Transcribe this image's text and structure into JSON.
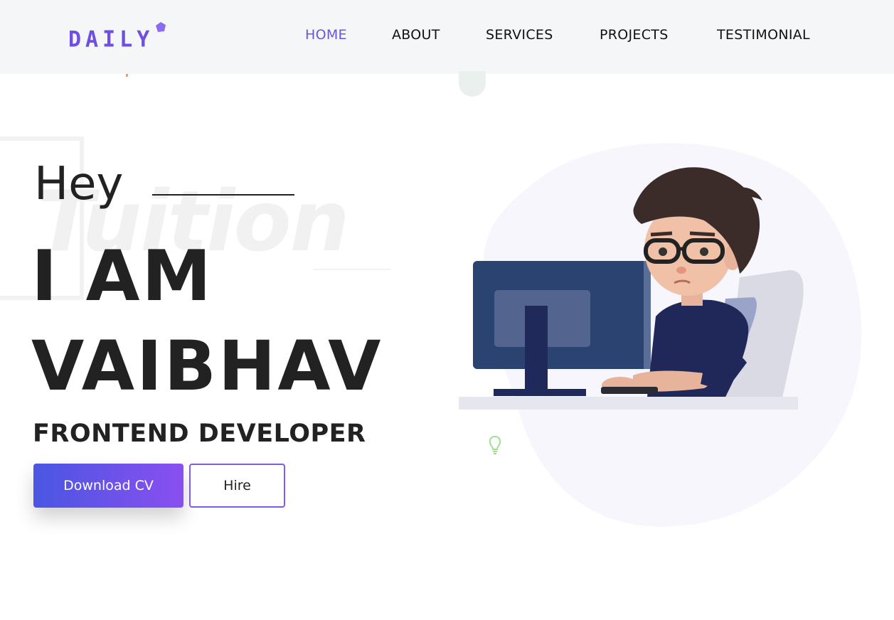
{
  "brand": {
    "logo_text": "DAILY",
    "accent": "#6f4ee4"
  },
  "nav": {
    "items": [
      {
        "label": "HOME",
        "active": true
      },
      {
        "label": "ABOUT",
        "active": false
      },
      {
        "label": "SERVICES",
        "active": false
      },
      {
        "label": "PROJECTS",
        "active": false
      },
      {
        "label": "TESTIMONIAL",
        "active": false
      }
    ],
    "active_color": "#6a55e0"
  },
  "hero": {
    "background_word": "Tuition",
    "greeting": "Hey",
    "title_line1": "I AM",
    "title_line2": "VAIBHAV",
    "subtitle": "FRONTEND DEVELOPER",
    "primary_button": "Download CV",
    "secondary_button": "Hire"
  },
  "illustration": {
    "icon": "developer-at-computer-illustration",
    "blob_color": "#f7f6fd"
  },
  "colors": {
    "button_gradient_start": "#4a56e2",
    "button_gradient_end": "#8a4ff0",
    "text": "#222222",
    "topbar": "#f5f6f8"
  }
}
